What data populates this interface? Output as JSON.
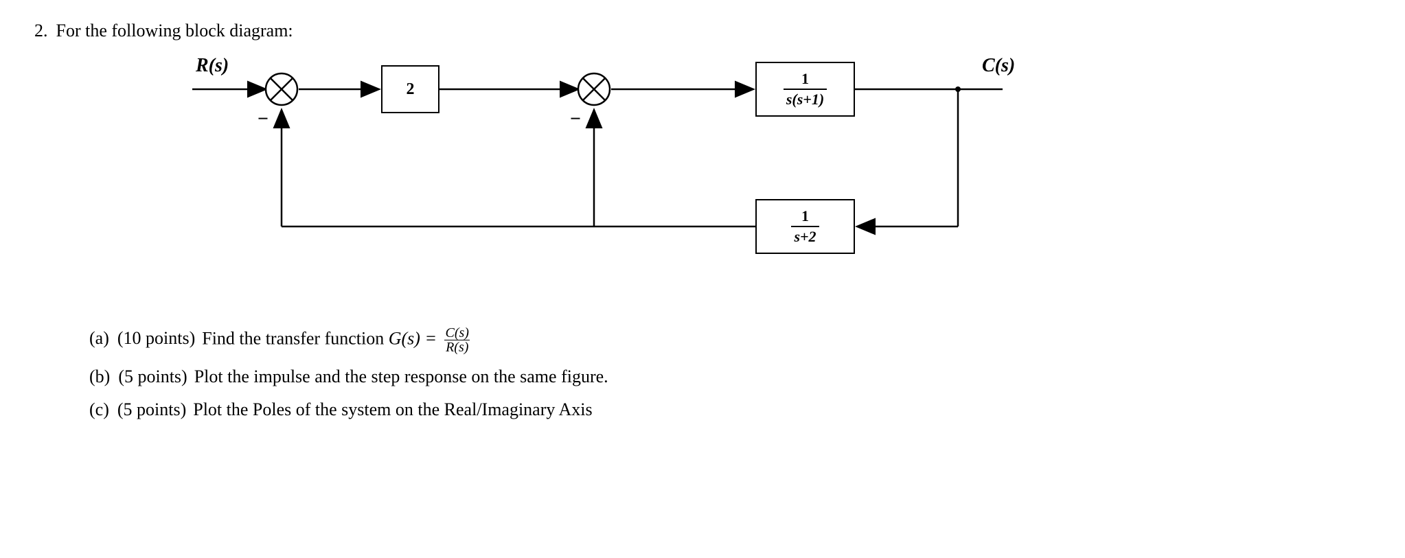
{
  "problem": {
    "number": "2.",
    "prompt": "For the following block diagram:"
  },
  "diagram": {
    "input_label": "R(s)",
    "output_label": "C(s)",
    "block1_label": "2",
    "block2_num": "1",
    "block2_den": "s(s+1)",
    "block3_num": "1",
    "block3_den": "s+2",
    "minus1": "−",
    "minus2": "−"
  },
  "subparts": {
    "a": {
      "label": "(a)",
      "points": "(10 points)",
      "text_before": "Find the transfer function ",
      "g_of_s": "G(s) = ",
      "frac_num": "C(s)",
      "frac_den": "R(s)"
    },
    "b": {
      "label": "(b)",
      "points": "(5 points)",
      "text": "Plot the impulse and the step response on the same figure."
    },
    "c": {
      "label": "(c)",
      "points": "(5 points)",
      "text": "Plot the Poles of the system on the Real/Imaginary Axis"
    }
  }
}
